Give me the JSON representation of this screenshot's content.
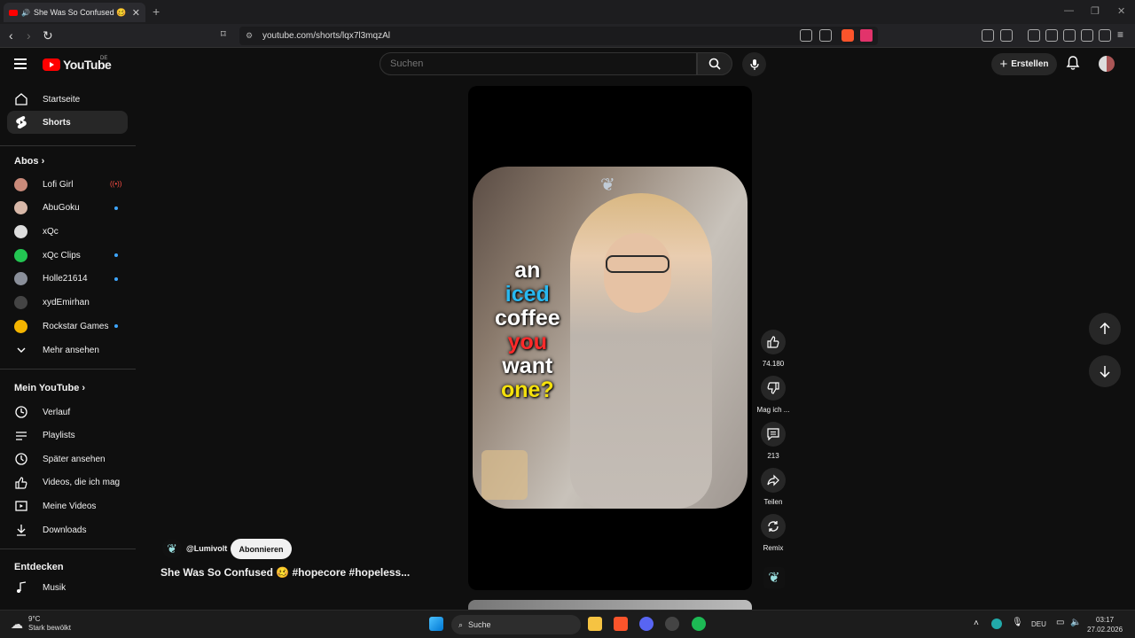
{
  "browser": {
    "tab_title": "She Was So Confused 🥴 #h",
    "url": "youtube.com/shorts/lqx7l3mqzAl",
    "close_glyph": "✕",
    "newtab_glyph": "+"
  },
  "header": {
    "logo_text": "YouTube",
    "region": "DE",
    "search_placeholder": "Suchen",
    "create_label": "Erstellen"
  },
  "sidebar": {
    "main": [
      {
        "label": "Startseite",
        "icon": "home-icon"
      },
      {
        "label": "Shorts",
        "icon": "shorts-icon",
        "active": true
      }
    ],
    "subs_heading": "Abos",
    "subscriptions": [
      {
        "label": "Lofi Girl",
        "color": "#c98a7a",
        "indicator": "live"
      },
      {
        "label": "AbuGoku",
        "color": "#d8b8a8",
        "indicator": "dot"
      },
      {
        "label": "xQc",
        "color": "#dddddd",
        "indicator": ""
      },
      {
        "label": "xQc Clips",
        "color": "#23c552",
        "indicator": "dot"
      },
      {
        "label": "Holle21614",
        "color": "#8a8f9a",
        "indicator": "dot"
      },
      {
        "label": "xydEmirhan",
        "color": "#444444",
        "indicator": ""
      },
      {
        "label": "Rockstar Games",
        "color": "#f4b400",
        "indicator": "dot"
      }
    ],
    "more_label": "Mehr ansehen",
    "you_heading": "Mein YouTube",
    "you_items": [
      {
        "label": "Verlauf",
        "icon": "history-icon"
      },
      {
        "label": "Playlists",
        "icon": "playlists-icon"
      },
      {
        "label": "Später ansehen",
        "icon": "watch-later-icon"
      },
      {
        "label": "Videos, die ich mag",
        "icon": "liked-videos-icon"
      },
      {
        "label": "Meine Videos",
        "icon": "my-videos-icon"
      },
      {
        "label": "Downloads",
        "icon": "downloads-icon"
      }
    ],
    "explore_heading": "Entdecken",
    "explore_items": [
      {
        "label": "Musik",
        "icon": "music-icon"
      }
    ]
  },
  "video": {
    "caption_lines": [
      {
        "text": "an",
        "color": "#ffffff"
      },
      {
        "text": "iced",
        "color": "#28b8f0"
      },
      {
        "text": "coffee",
        "color": "#ffffff"
      },
      {
        "text": "you",
        "color": "#ff2a2a"
      },
      {
        "text": "want",
        "color": "#ffffff"
      },
      {
        "text": "one?",
        "color": "#f5e10c"
      }
    ],
    "channel_handle": "@Lumivolt",
    "subscribe_label": "Abonnieren",
    "title": "She Was So Confused 🥴 #hopecore #hopeless..."
  },
  "actions": {
    "likes": "74.180",
    "dislike_label": "Mag ich ...",
    "comments": "213",
    "share_label": "Teilen",
    "remix_label": "Remix"
  },
  "taskbar": {
    "temp": "9°C",
    "weather": "Stark bewölkt",
    "search_label": "Suche",
    "lang": "DEU",
    "time": "03:17",
    "date": "27.02.2026"
  }
}
